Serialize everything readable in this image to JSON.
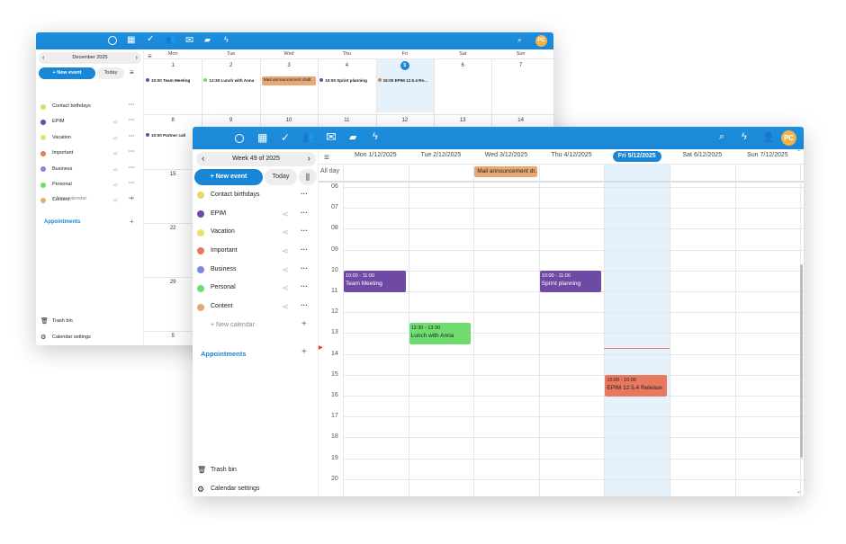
{
  "back": {
    "period": "December 2025",
    "new_event": "+ New event",
    "today": "Today",
    "days": [
      "Mon",
      "Tue",
      "Wed",
      "Thu",
      "Fri",
      "Sat",
      "Sun"
    ],
    "week1": [
      "1",
      "2",
      "3",
      "4",
      "5",
      "6",
      "7"
    ],
    "week2": [
      "8",
      "9",
      "10",
      "11",
      "12",
      "13",
      "14"
    ],
    "col1": [
      "15",
      "22",
      "29",
      "5"
    ],
    "events": {
      "mon1": "10:00 Team Meeting",
      "tue1": "12:30 Lunch with Anna",
      "wed1": "Mail announcement draft",
      "thu1": "10:00 Sprint planning",
      "fri1": "15:00 EPIM 12.5.4 Re...",
      "mon2": "10:00 Partner call"
    },
    "calendars": [
      "Contact birthdays",
      "EPIM",
      "Vacation",
      "Important",
      "Business",
      "Personal",
      "Content"
    ],
    "new_calendar": "+ New calendar",
    "appointments": "Appointments",
    "trash": "Trash bin",
    "settings": "Calendar settings",
    "avatar": "PC"
  },
  "front": {
    "period": "Week 49 of 2025",
    "new_event": "+ New event",
    "today": "Today",
    "calendars": [
      "Contact birthdays",
      "EPIM",
      "Vacation",
      "Important",
      "Business",
      "Personal",
      "Content"
    ],
    "new_calendar": "+ New calendar",
    "appointments": "Appointments",
    "trash": "Trash bin",
    "settings": "Calendar settings",
    "avatar": "PC",
    "all_day": "All day",
    "days": [
      "Mon 1/12/2025",
      "Tue 2/12/2025",
      "Wed 3/12/2025",
      "Thu 4/12/2025",
      "Fri 5/12/2025",
      "Sat 6/12/2025",
      "Sun 7/12/2025"
    ],
    "hours": [
      "06",
      "07",
      "08",
      "09",
      "10",
      "11",
      "12",
      "13",
      "14",
      "15",
      "16",
      "17",
      "18",
      "19",
      "20"
    ],
    "allday_event": "Mail announcement dr...",
    "events": [
      {
        "time": "10:00 - 11:00",
        "title": "Team Meeting"
      },
      {
        "time": "10:00 - 11:00",
        "title": "Sprint planning"
      },
      {
        "time": "12:30 - 13:30",
        "title": "Lunch with Anna"
      },
      {
        "time": "15:00 - 16:00",
        "title": "EPIM 12.5.4 Release"
      }
    ]
  },
  "colors": {
    "brand": "#1a86d6",
    "epim": "#6e4aa5",
    "birthday": "#e8d865",
    "vacation": "#e8e06b",
    "important": "#e8785e",
    "business": "#7b86e8",
    "personal": "#6fdc6f",
    "content": "#e8a874",
    "today_bg": "#e6f2fb",
    "now_line": "#e8785e"
  },
  "icons": [
    "circle-icon",
    "calendar-icon",
    "check-icon",
    "contacts-icon",
    "mail-icon",
    "files-icon",
    "activity-icon",
    "search-icon",
    "notifications-icon",
    "contacts-menu-icon"
  ]
}
